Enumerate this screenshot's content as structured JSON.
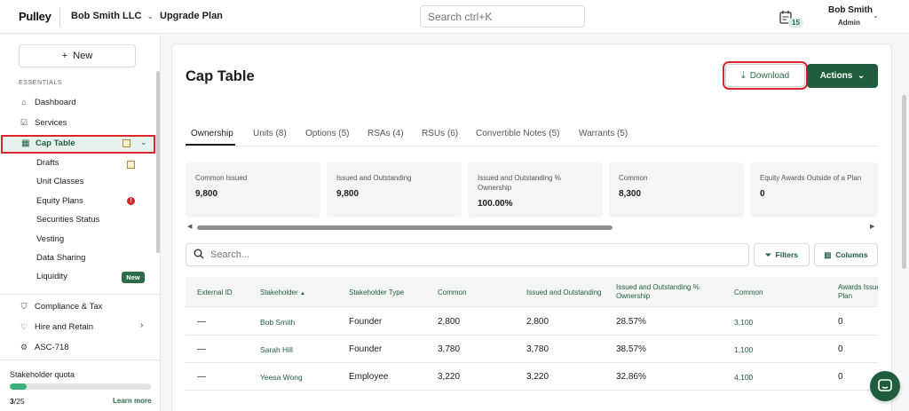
{
  "header": {
    "logo": "Pulley",
    "company": "Bob Smith LLC",
    "upgrade": "Upgrade Plan",
    "search_placeholder": "Search ctrl+K",
    "notifications_count": "15",
    "user_name": "Bob Smith",
    "user_role": "Admin"
  },
  "sidebar": {
    "new_button": "New",
    "section_label": "ESSENTIALS",
    "items": [
      {
        "label": "Dashboard",
        "icon": "home-icon"
      },
      {
        "label": "Services",
        "icon": "checkbox-icon"
      },
      {
        "label": "Cap Table",
        "icon": "grid-icon"
      },
      {
        "label": "Compliance & Tax",
        "icon": "shield-icon"
      },
      {
        "label": "Hire and Retain",
        "icon": "heart-icon"
      },
      {
        "label": "ASC-718",
        "icon": "gear-icon"
      }
    ],
    "cap_sub": [
      "Drafts",
      "Unit Classes",
      "Equity Plans",
      "Securities Status",
      "Vesting",
      "Data Sharing",
      "Liquidity"
    ],
    "new_badge": "New",
    "quota_title": "Stakeholder quota",
    "quota_used": "3",
    "quota_total": "/25",
    "quota_fraction": 0.12,
    "learn_more": "Learn more"
  },
  "main": {
    "title": "Cap Table",
    "download": "Download",
    "actions": "Actions",
    "tabs": [
      "Ownership",
      "Units (8)",
      "Options (5)",
      "RSAs (4)",
      "RSUs (6)",
      "Convertible Notes (5)",
      "Warrants (5)"
    ],
    "stats": [
      {
        "label": "Common Issued",
        "value": "9,800"
      },
      {
        "label": "Issued and Outstanding",
        "value": "9,800"
      },
      {
        "label": "Issued and Outstanding % Ownership",
        "value": "100.00%"
      },
      {
        "label": "Common",
        "value": "8,300"
      },
      {
        "label": "Equity Awards Outside of a Plan",
        "value": "0"
      }
    ],
    "search_placeholder": "Search...",
    "filters": "Filters",
    "columns": "Columns",
    "table": {
      "headers": [
        "External ID",
        "Stakeholder",
        "Stakeholder Type",
        "Common",
        "Issued and Outstanding",
        "Issued and Outstanding % Ownership",
        "Common",
        "Awards Issued Plan"
      ],
      "rows": [
        [
          "—",
          "Bob Smith",
          "Founder",
          "2,800",
          "2,800",
          "28.57%",
          "3,100",
          "0"
        ],
        [
          "—",
          "Sarah Hill",
          "Founder",
          "3,780",
          "3,780",
          "38.57%",
          "1,100",
          "0"
        ],
        [
          "—",
          "Yeesa Wong",
          "Employee",
          "3,220",
          "3,220",
          "32.86%",
          "4,100",
          "0"
        ]
      ]
    }
  },
  "colors": {
    "brand_green": "#1f5d3e",
    "highlight_red": "#d9252b",
    "quota_fill": "#3db07a"
  }
}
